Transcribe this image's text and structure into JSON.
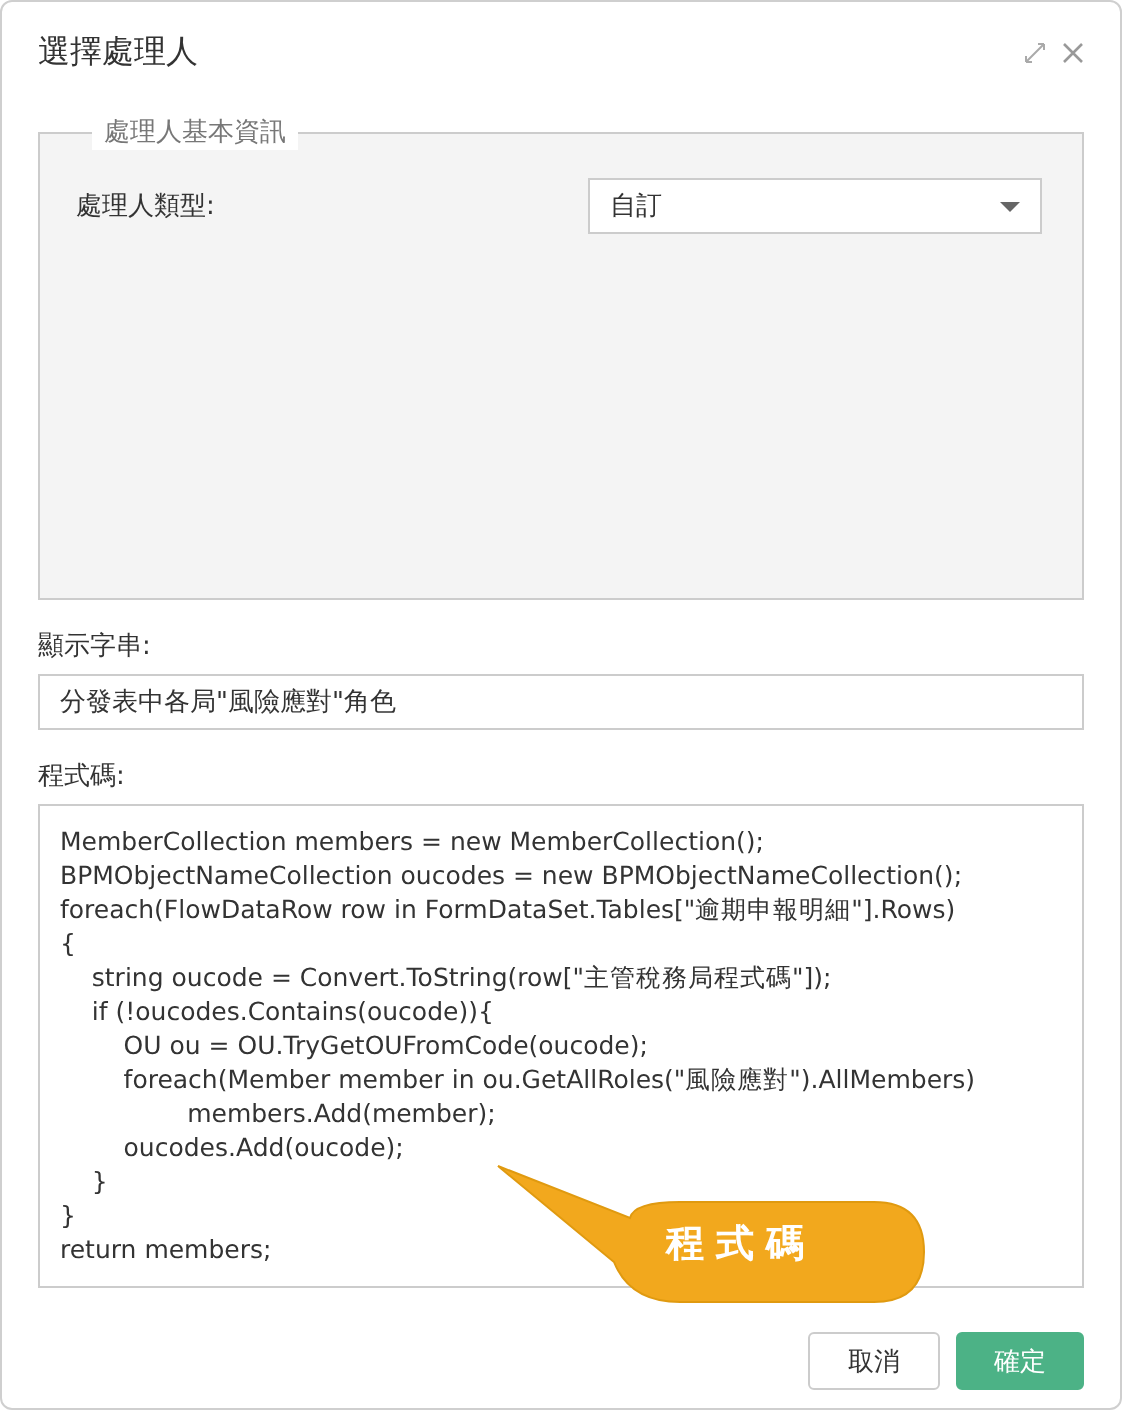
{
  "window": {
    "title": "選擇處理人"
  },
  "basic_info": {
    "legend": "處理人基本資訊",
    "type_label": "處理人類型:",
    "type_value": "自訂"
  },
  "display_string": {
    "label": "顯示字串:",
    "value": "分發表中各局\"風險應對\"角色"
  },
  "code": {
    "label": "程式碼:",
    "value": "MemberCollection members = new MemberCollection();\nBPMObjectNameCollection oucodes = new BPMObjectNameCollection();\nforeach(FlowDataRow row in FormDataSet.Tables[\"逾期申報明細\"].Rows)\n{\n    string oucode = Convert.ToString(row[\"主管稅務局程式碼\"]);\n    if (!oucodes.Contains(oucode)){\n        OU ou = OU.TryGetOUFromCode(oucode);\n        foreach(Member member in ou.GetAllRoles(\"風險應對\").AllMembers)\n                members.Add(member);\n        oucodes.Add(oucode);\n    }\n}\nreturn members;"
  },
  "callout": {
    "text": "程式碼"
  },
  "buttons": [
    {
      "label": "取消",
      "kind": "secondary"
    },
    {
      "label": "確定",
      "kind": "primary"
    }
  ]
}
